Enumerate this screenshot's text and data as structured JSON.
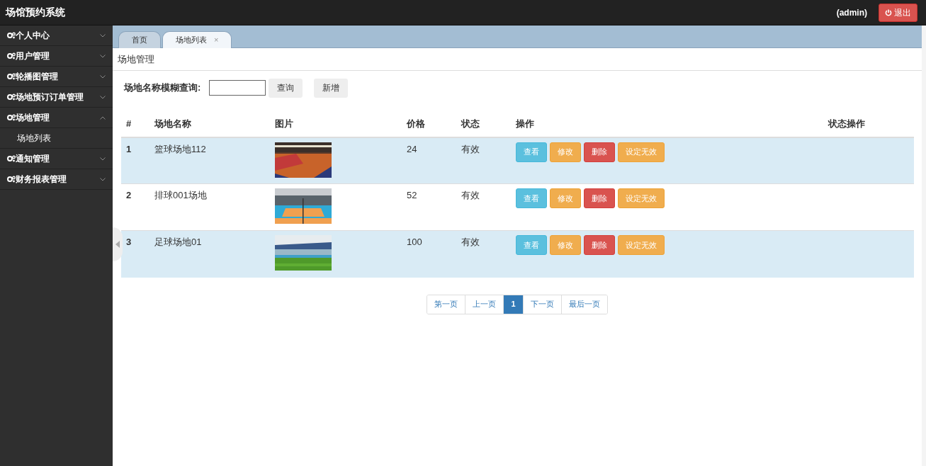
{
  "app_title": "场馆预约系统",
  "user": "(admin)",
  "logout": {
    "label": "退出"
  },
  "sidebar": {
    "items": [
      {
        "label": "个人中心",
        "expanded": false
      },
      {
        "label": "用户管理",
        "expanded": false
      },
      {
        "label": "轮播图管理",
        "expanded": false
      },
      {
        "label": "场地预订订单管理",
        "expanded": false
      },
      {
        "label": "场地管理",
        "expanded": true,
        "children": [
          {
            "label": "场地列表"
          }
        ]
      },
      {
        "label": "通知管理",
        "expanded": false
      },
      {
        "label": "财务报表管理",
        "expanded": false
      }
    ]
  },
  "tabs": [
    {
      "label": "首页",
      "selected": false
    },
    {
      "label": "场地列表",
      "selected": true,
      "close": "×"
    }
  ],
  "breadcrumb": "场地管理",
  "search": {
    "label": "场地名称模糊查询:",
    "buttons": [
      "查询",
      "新增"
    ]
  },
  "table": {
    "columns": [
      "#",
      "场地名称",
      "图片",
      "价格",
      "状态",
      "操作",
      "状态操作"
    ],
    "rows": [
      {
        "index": "1",
        "name": "篮球场地112",
        "picture": {
          "kind": "picture"
        },
        "price": "24",
        "status": "有效",
        "actions": [
          {
            "label": "查看",
            "kind": "info"
          },
          {
            "label": "修改",
            "kind": "warning"
          },
          {
            "label": "删除",
            "kind": "danger"
          },
          {
            "label": "设定无效",
            "kind": "warning"
          }
        ]
      },
      {
        "index": "2",
        "name": "排球001场地",
        "picture": {
          "kind": "picture"
        },
        "price": "52",
        "status": "有效",
        "actions": [
          {
            "label": "查看",
            "kind": "info"
          },
          {
            "label": "修改",
            "kind": "warning"
          },
          {
            "label": "删除",
            "kind": "danger"
          },
          {
            "label": "设定无效",
            "kind": "warning"
          }
        ]
      },
      {
        "index": "3",
        "name": "足球场地01",
        "picture": {
          "kind": "picture"
        },
        "price": "100",
        "status": "有效",
        "actions": [
          {
            "label": "查看",
            "kind": "info"
          },
          {
            "label": "修改",
            "kind": "warning"
          },
          {
            "label": "删除",
            "kind": "danger"
          },
          {
            "label": "设定无效",
            "kind": "warning"
          }
        ]
      }
    ]
  },
  "pagination": [
    {
      "label": "第一页",
      "selected": false
    },
    {
      "label": "上一页",
      "selected": false
    },
    {
      "label": "1",
      "selected": true
    },
    {
      "label": "下一页",
      "selected": false
    },
    {
      "label": "最后一页",
      "selected": false
    }
  ]
}
